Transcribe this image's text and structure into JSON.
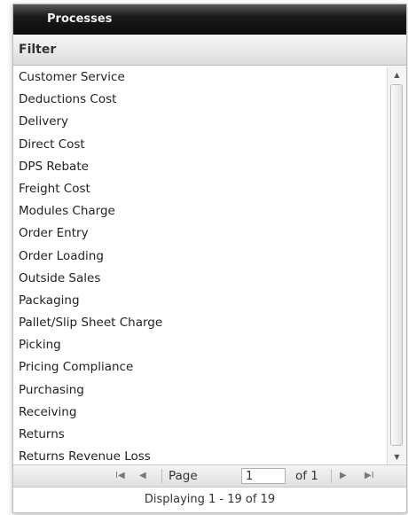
{
  "window": {
    "title": "Processes"
  },
  "filter": {
    "label": "Filter"
  },
  "list": {
    "items": [
      "Customer Service",
      "Deductions Cost",
      "Delivery",
      "Direct Cost",
      "DPS Rebate",
      "Freight Cost",
      "Modules Charge",
      "Order Entry",
      "Order Loading",
      "Outside Sales",
      "Packaging",
      "Pallet/Slip Sheet Charge",
      "Picking",
      "Pricing Compliance",
      "Purchasing",
      "Receiving",
      "Returns",
      "Returns Revenue Loss"
    ]
  },
  "pager": {
    "page_label": "Page",
    "page_value": "1",
    "of_label": "of 1",
    "first_icon": "first-page-icon",
    "prev_icon": "prev-page-icon",
    "next_icon": "next-page-icon",
    "last_icon": "last-page-icon"
  },
  "status": {
    "text": "Displaying 1 - 19 of 19"
  }
}
